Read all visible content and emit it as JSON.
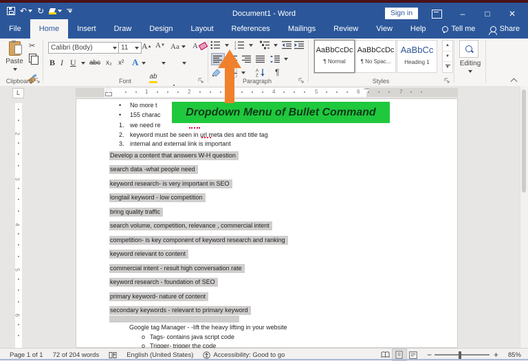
{
  "window": {
    "title": "Document1 - Word",
    "sign_in_label": "Sign in"
  },
  "tabs": {
    "items": [
      "File",
      "Home",
      "Insert",
      "Draw",
      "Design",
      "Layout",
      "References",
      "Mailings",
      "Review",
      "View",
      "Help"
    ],
    "active": "Home",
    "tell_me": "Tell me",
    "share": "Share"
  },
  "ribbon": {
    "clipboard": {
      "label": "Clipboard",
      "paste": "Paste"
    },
    "font": {
      "label": "Font",
      "name": "Calibri (Body)",
      "size": "11",
      "bold": "B",
      "italic": "I",
      "underline": "U",
      "strikethrough": "abc",
      "subscript": "x₂",
      "superscript": "x²",
      "grow_font": "A",
      "shrink_font": "A",
      "change_case": "Aa",
      "clear_format": "A",
      "text_effects": "A",
      "highlight": "ab",
      "font_color": "A"
    },
    "paragraph": {
      "label": "Paragraph"
    },
    "styles": {
      "label": "Styles",
      "items": [
        {
          "preview": "AaBbCcDc",
          "name": "¶ Normal"
        },
        {
          "preview": "AaBbCcDc",
          "name": "¶ No Spac..."
        },
        {
          "preview": "AaBbCc",
          "name": "Heading 1"
        }
      ]
    },
    "editing": {
      "label": "Editing"
    }
  },
  "annotation": {
    "label": "Dropdown Menu of Bullet Command",
    "box_color": "#1fc83d",
    "arrow_color": "#f0802b"
  },
  "document": {
    "bullet_items": [
      "No more t",
      "155 charac"
    ],
    "numbered_items": [
      {
        "marker": "1.",
        "text": "we need re"
      },
      {
        "marker": "2.",
        "text": "keyword must be seen in url meta des and title tag"
      },
      {
        "marker": "3.",
        "text": "internal and external link is important"
      }
    ],
    "highlighted_lines": [
      "Develop a content that answers W-H question",
      "search data -what people need",
      "keyword research- is very important in SEO",
      "longtail keyword - low competition",
      "bring quality traffic",
      "search volume, competition, relevance , commercial intent",
      "competition- is key component of keyword research and ranking",
      "keyword relevant to content",
      "commercial intent - result high conversation rate",
      "keyword research - foundation of SEO",
      "primary keyword- nature of content",
      "secondary keywords - relevant to primary keyword"
    ],
    "plain_line": "Google tag Manager - -lift the heavy lifting in your website",
    "circle_items": [
      {
        "marker": "o",
        "text": "Tags- contains java script code"
      },
      {
        "marker": "o",
        "text": "Trigger- trigger the code"
      }
    ],
    "highlight_color": "#d0cecd"
  },
  "ruler": {
    "h_numbers": [
      "1",
      "2",
      "3",
      "4",
      "5",
      "6",
      "7"
    ],
    "v_numbers": [
      "2",
      "3",
      "4",
      "5",
      "6"
    ]
  },
  "status": {
    "page": "Page 1 of 1",
    "words": "72 of 204 words",
    "language": "English (United States)",
    "accessibility": "Accessibility: Good to go",
    "zoom": "85%"
  },
  "icons": {
    "undo": "↶",
    "redo": "↻",
    "cut": "✂",
    "pilcrow": "¶",
    "tab_selector": "L",
    "scroll_up": "▲",
    "scroll_down": "▼"
  }
}
